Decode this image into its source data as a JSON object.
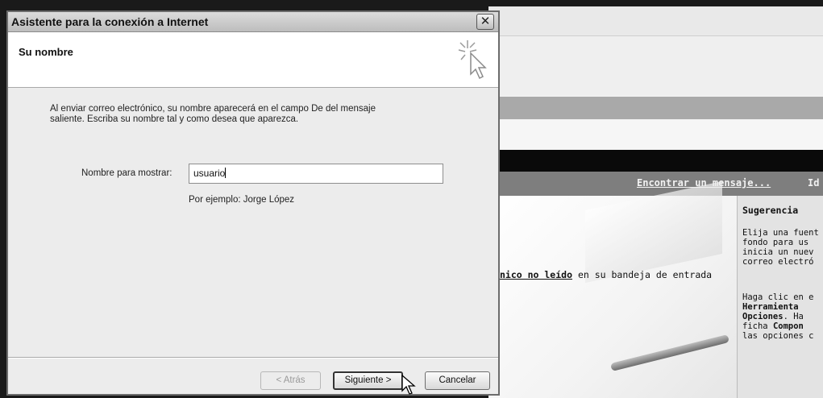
{
  "background_window": {
    "find_link": "Encontrar un mensaje...",
    "find_link_cut": "Id",
    "unread_link": "nico no leído",
    "unread_text": " en su bandeja de entrada",
    "tip_title": "Sugerencia",
    "tip_p1": "Elija una fuent\nfondo para us\ninicia un nuev\ncorreo electró",
    "tip_p2_lines": [
      {
        "text": "Haga clic en e",
        "bold": false
      },
      {
        "text": "Herramienta",
        "bold": true
      },
      {
        "text": "Opciones",
        "bold": true,
        "suffix": ". Ha"
      },
      {
        "text": "ficha ",
        "bold": false,
        "bold_suffix": "Compon"
      },
      {
        "text": "las opciones c",
        "bold": false
      }
    ]
  },
  "dialog": {
    "title": "Asistente para la conexión a Internet",
    "close_glyph": "✕",
    "header_title": "Su nombre",
    "description": "Al enviar correo electrónico, su nombre aparecerá en el campo De del mensaje\nsaliente. Escriba su nombre tal y como desea que aparezca.",
    "field_label": "Nombre para mostrar:",
    "field_value": "usuario",
    "example": "Por ejemplo: Jorge López",
    "buttons": {
      "back": "< Atrás",
      "next": "Siguiente >",
      "cancel": "Cancelar"
    }
  },
  "icons": [
    "wizard-sparkle-icon",
    "mouse-cursor-icon",
    "close-icon"
  ]
}
